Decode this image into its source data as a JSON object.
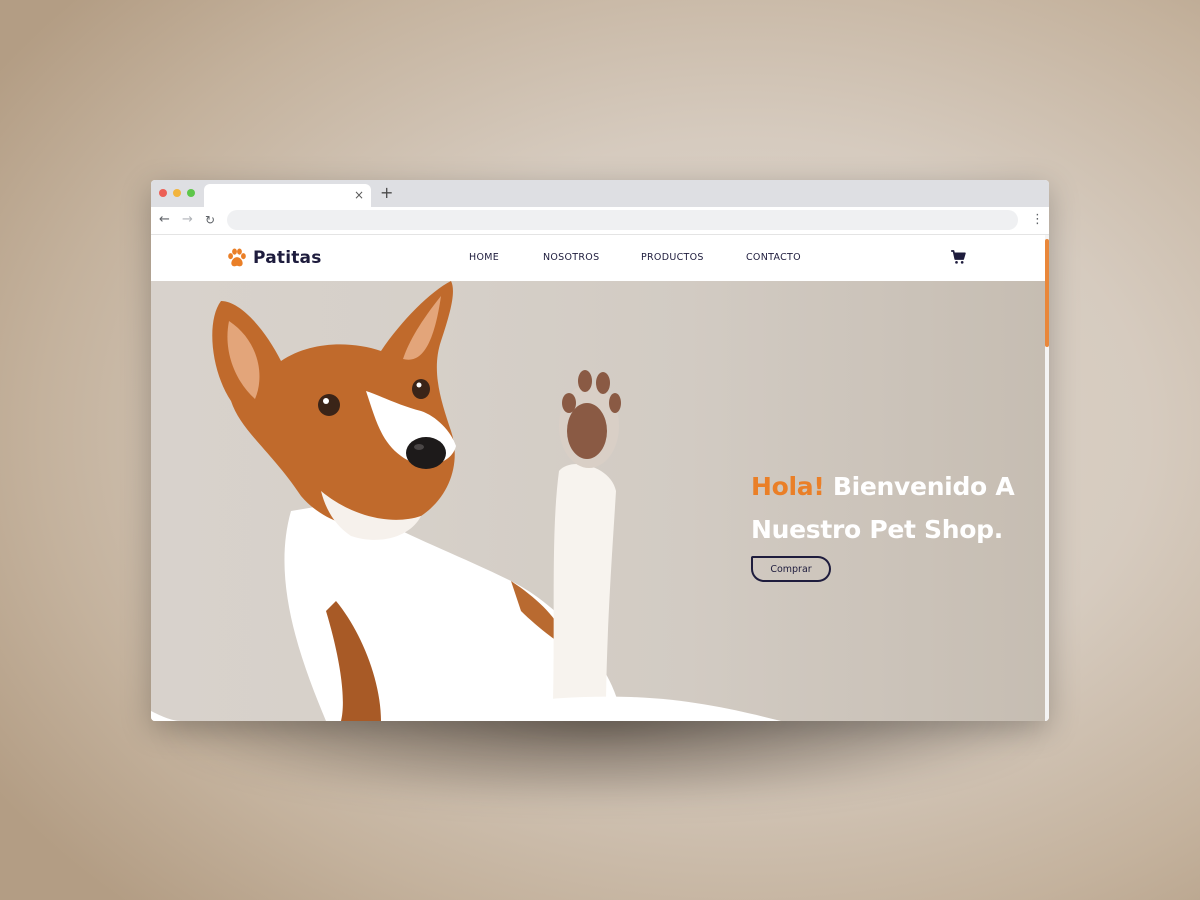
{
  "browser": {
    "tab_close": "×",
    "new_tab": "+",
    "back": "←",
    "forward": "→",
    "reload": "↻",
    "menu": "⋮",
    "url": ""
  },
  "site": {
    "logo_text": "Patitas",
    "nav": {
      "home": "HOME",
      "nosotros": "NOSOTROS",
      "productos": "PRODUCTOS",
      "contacto": "CONTACTO"
    },
    "hero": {
      "title_accent": "Hola!",
      "title_rest": "Bienvenido A Nuestro Pet Shop.",
      "cta_label": "Comprar"
    }
  },
  "colors": {
    "accent": "#ea7f27",
    "navy": "#1e1c3d",
    "hero_bg": "#d6d0c9"
  },
  "icons": {
    "logo": "paw-icon",
    "cart": "shopping-cart-icon"
  }
}
